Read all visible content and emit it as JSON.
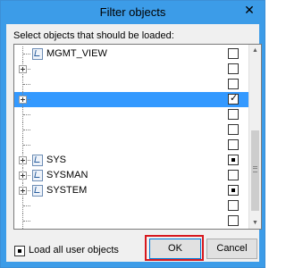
{
  "window": {
    "title": "Filter objects",
    "close_label": "✕"
  },
  "instruction": "Select objects that should be loaded:",
  "list": [
    {
      "label": "MGMT_VIEW",
      "icon": true,
      "state": "unchecked",
      "expander": false,
      "selected": false
    },
    {
      "label": "",
      "icon": false,
      "state": "unchecked",
      "expander": true,
      "selected": false
    },
    {
      "label": "",
      "icon": false,
      "state": "unchecked",
      "expander": false,
      "selected": false
    },
    {
      "label": "",
      "icon": false,
      "state": "checked",
      "expander": true,
      "selected": true
    },
    {
      "label": "",
      "icon": false,
      "state": "unchecked",
      "expander": false,
      "selected": false
    },
    {
      "label": "",
      "icon": false,
      "state": "unchecked",
      "expander": false,
      "selected": false
    },
    {
      "label": "",
      "icon": false,
      "state": "unchecked",
      "expander": false,
      "selected": false
    },
    {
      "label": "SYS",
      "icon": true,
      "state": "mixed",
      "expander": true,
      "selected": false
    },
    {
      "label": "SYSMAN",
      "icon": true,
      "state": "unchecked",
      "expander": true,
      "selected": false
    },
    {
      "label": "SYSTEM",
      "icon": true,
      "state": "mixed",
      "expander": true,
      "selected": false
    },
    {
      "label": "",
      "icon": false,
      "state": "unchecked",
      "expander": false,
      "selected": false
    },
    {
      "label": "",
      "icon": false,
      "state": "unchecked",
      "expander": false,
      "selected": false
    }
  ],
  "footer": {
    "load_all_label": "Load all user objects",
    "load_all_state": "mixed"
  },
  "buttons": {
    "ok": "OK",
    "cancel": "Cancel"
  },
  "colors": {
    "titlebar": "#3c9ce8",
    "selection": "#3399ff",
    "highlight": "#d7191f"
  },
  "icons": {
    "close": "close-icon",
    "object": "schema-object-icon",
    "expand": "expand-plus-icon"
  }
}
